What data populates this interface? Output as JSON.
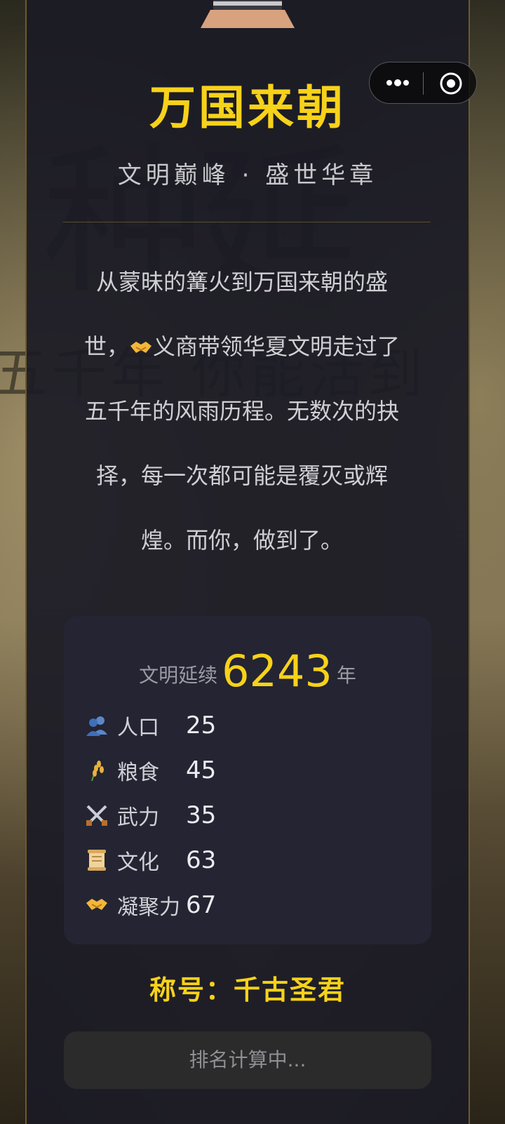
{
  "header": {
    "title": "万国来朝",
    "subtitle": "文明巅峰 · 盛世华章"
  },
  "background": {
    "large_text": "种延",
    "small_text": "五千年 你能活到"
  },
  "capsule": {
    "more_icon": "more-dots-icon",
    "close_icon": "target-circle-icon"
  },
  "story": {
    "part1": "从蒙昧的篝火到万国来朝的盛世，",
    "icon": "handshake-icon",
    "part2": "义商带领华夏文明走过了五千年的风雨历程。无数次的抉择，每一次都可能是覆灭或辉煌。而你，做到了。"
  },
  "summary": {
    "prefix": "文明延续",
    "years": "6243",
    "suffix": "年"
  },
  "stats": [
    {
      "icon": "people-icon",
      "label": "人口",
      "value": "25"
    },
    {
      "icon": "grain-icon",
      "label": "粮食",
      "value": "45"
    },
    {
      "icon": "crossed-swords-icon",
      "label": "武力",
      "value": "35"
    },
    {
      "icon": "scroll-icon",
      "label": "文化",
      "value": "63"
    },
    {
      "icon": "handshake-icon",
      "label": "凝聚力",
      "value": "67"
    }
  ],
  "rank": {
    "title": "称号：千古圣君",
    "status": "排名计算中..."
  },
  "colors": {
    "accent": "#f7d21a",
    "panel": "#1b1b26",
    "card": "#242433"
  }
}
